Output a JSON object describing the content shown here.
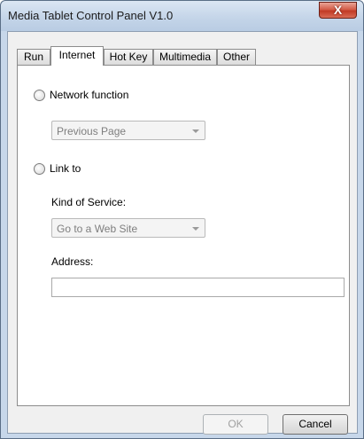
{
  "window": {
    "title": "Media Tablet Control Panel V1.0",
    "close_glyph": "X"
  },
  "tabs": [
    {
      "label": "Run"
    },
    {
      "label": "Internet",
      "active": true
    },
    {
      "label": "Hot Key"
    },
    {
      "label": "Multimedia"
    },
    {
      "label": "Other"
    }
  ],
  "internet": {
    "network_function": {
      "label": "Network function",
      "selected": false,
      "dropdown_value": "Previous Page"
    },
    "link_to": {
      "label": "Link to",
      "selected": false
    },
    "kind_of_service": {
      "label": "Kind of Service:",
      "value": "Go to a Web Site"
    },
    "address": {
      "label": "Address:",
      "value": ""
    }
  },
  "buttons": {
    "ok": "OK",
    "cancel": "Cancel"
  }
}
